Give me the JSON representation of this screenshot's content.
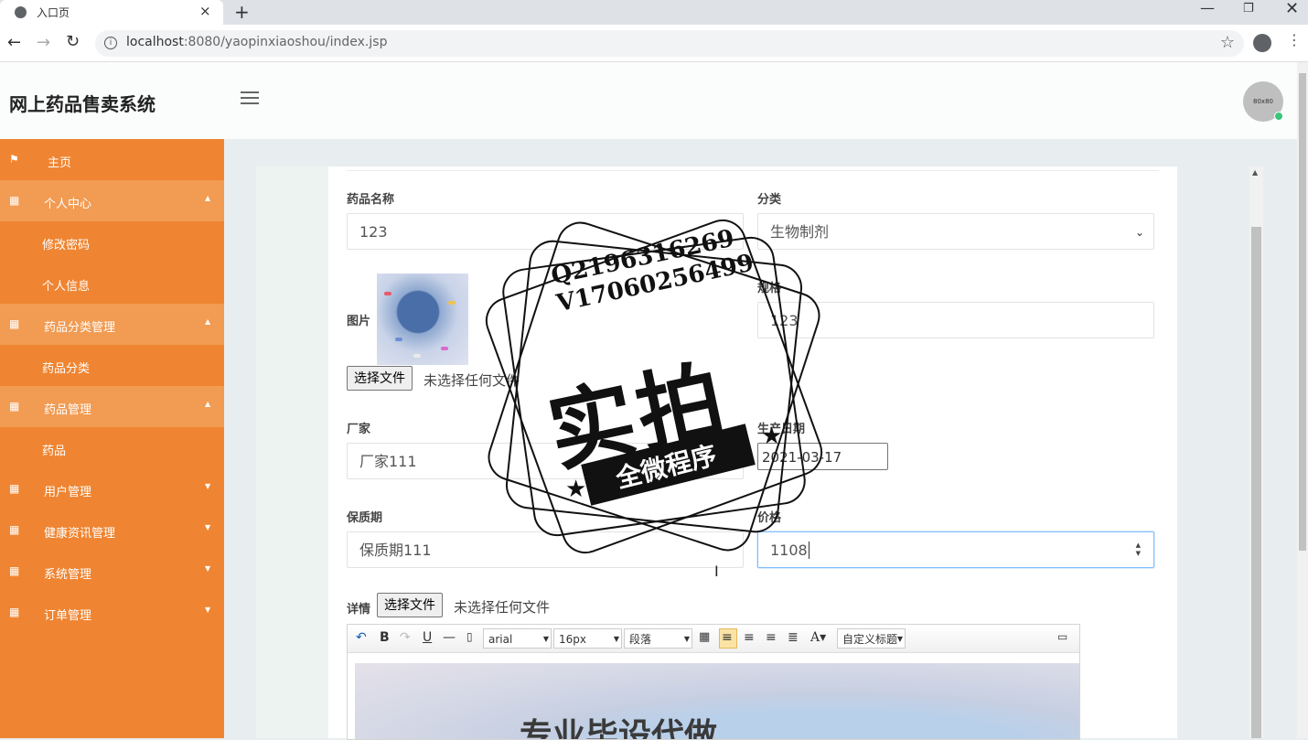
{
  "browser": {
    "tab_title": "入口页",
    "tab_close": "×",
    "new_tab": "+",
    "url_host": "localhost",
    "url_rest": ":8080/yaopinxiaoshou/index.jsp",
    "icons": [
      "favicon-icon",
      "close-icon",
      "plus-icon",
      "back-icon",
      "forward-icon",
      "reload-icon",
      "info-icon",
      "star-icon",
      "profile-icon",
      "more-icon",
      "minimize-icon",
      "restore-icon",
      "window-close-icon"
    ]
  },
  "header": {
    "brand": "网上药品售卖系统",
    "avatar_text": "80x80"
  },
  "sidebar": {
    "items": [
      {
        "label": "主页",
        "icon": "flag-icon"
      },
      {
        "label": "个人中心",
        "icon": "grid-icon",
        "open": true
      },
      {
        "label": "修改密码"
      },
      {
        "label": "个人信息"
      },
      {
        "label": "药品分类管理",
        "icon": "grid-icon",
        "open": true
      },
      {
        "label": "药品分类"
      },
      {
        "label": "药品管理",
        "icon": "grid-icon",
        "open": true
      },
      {
        "label": "药品"
      },
      {
        "label": "用户管理",
        "icon": "grid-icon"
      },
      {
        "label": "健康资讯管理",
        "icon": "grid-icon"
      },
      {
        "label": "系统管理",
        "icon": "grid-icon"
      },
      {
        "label": "订单管理",
        "icon": "grid-icon"
      }
    ],
    "color": "#ef8532"
  },
  "form": {
    "name_label": "药品名称",
    "name_value": "123",
    "category_label": "分类",
    "category_value": "生物制剂",
    "image_label": "图片",
    "spec_label": "规格",
    "spec_value": "123",
    "file_button": "选择文件",
    "file_note": "未选择任何文件",
    "maker_label": "厂家",
    "maker_value": "厂家111",
    "date_label": "生产日期",
    "date_value": "2021-03-17",
    "shelf_label": "保质期",
    "shelf_value": "保质期111",
    "price_label": "价格",
    "price_value": "1108",
    "detail_label": "详情"
  },
  "editor": {
    "font_family": "arial",
    "font_size": "16px",
    "paragraph": "段落",
    "custom_title": "自定义标题",
    "body_text": "专业毕设代做"
  },
  "watermark": {
    "qq": "Q2196316269",
    "wechat": "V17060256499",
    "main": "实拍",
    "sub": "全微程序"
  }
}
